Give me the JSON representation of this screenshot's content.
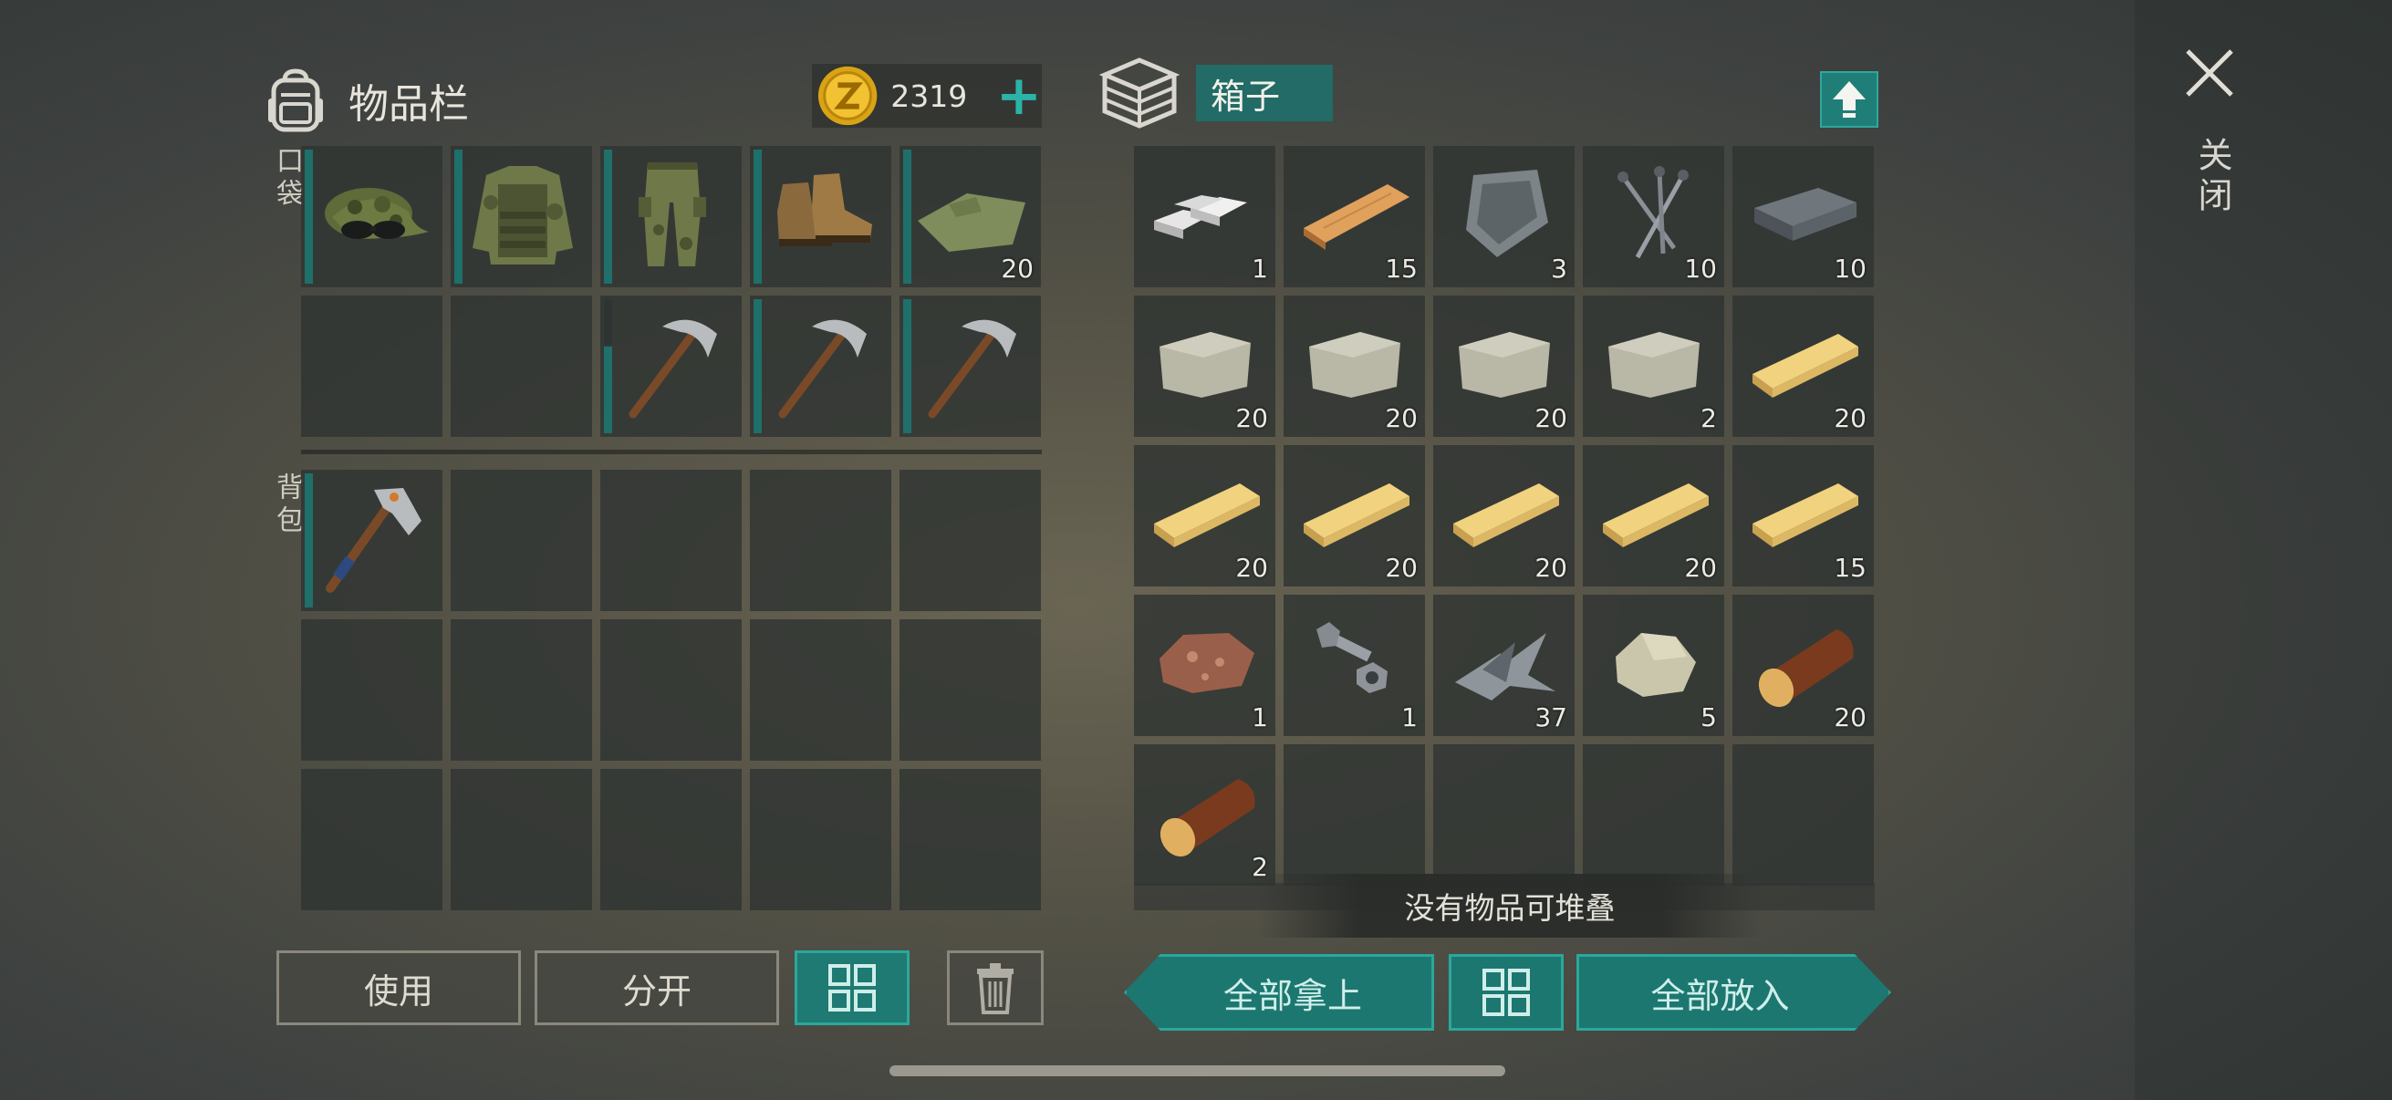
{
  "inventory": {
    "title": "物品栏",
    "coins": "2319",
    "plus": "+",
    "pocket_label": "口袋",
    "bag_label": "背包",
    "pocket_row1": [
      {
        "item": "camo-cap",
        "qty": ""
      },
      {
        "item": "camo-vest-jacket",
        "qty": ""
      },
      {
        "item": "camo-pants",
        "qty": ""
      },
      {
        "item": "leather-boots",
        "qty": ""
      },
      {
        "item": "cloth",
        "qty": "20"
      }
    ],
    "pocket_row2": [
      {
        "item": "empty",
        "qty": ""
      },
      {
        "item": "empty",
        "qty": ""
      },
      {
        "item": "pickaxe",
        "qty": ""
      },
      {
        "item": "pickaxe",
        "qty": ""
      },
      {
        "item": "pickaxe",
        "qty": ""
      }
    ],
    "bag_items": [
      {
        "item": "hatchet",
        "qty": ""
      }
    ]
  },
  "chest": {
    "title": "箱子",
    "items": [
      {
        "item": "aluminum-ingots",
        "qty": "1"
      },
      {
        "item": "wood-plank",
        "qty": "15"
      },
      {
        "item": "metal-plate",
        "qty": "3"
      },
      {
        "item": "nails",
        "qty": "10"
      },
      {
        "item": "iron-ingot",
        "qty": "10"
      },
      {
        "item": "stone",
        "qty": "20"
      },
      {
        "item": "stone",
        "qty": "20"
      },
      {
        "item": "stone",
        "qty": "20"
      },
      {
        "item": "stone",
        "qty": "2"
      },
      {
        "item": "pine-plank",
        "qty": "20"
      },
      {
        "item": "pine-plank",
        "qty": "20"
      },
      {
        "item": "pine-plank",
        "qty": "20"
      },
      {
        "item": "pine-plank",
        "qty": "20"
      },
      {
        "item": "pine-plank",
        "qty": "20"
      },
      {
        "item": "pine-plank",
        "qty": "15"
      },
      {
        "item": "iron-ore",
        "qty": "1"
      },
      {
        "item": "bolt-and-nut",
        "qty": "1"
      },
      {
        "item": "scrap-metal",
        "qty": "37"
      },
      {
        "item": "limestone",
        "qty": "5"
      },
      {
        "item": "log",
        "qty": "20"
      },
      {
        "item": "log",
        "qty": "2"
      }
    ],
    "toast": "没有物品可堆叠"
  },
  "buttons": {
    "use": "使用",
    "split": "分开",
    "take_all": "全部拿上",
    "put_all": "全部放入"
  },
  "close_label": "关闭",
  "colors": {
    "accent_teal": "#1e7a73",
    "accent_border": "#2aa89c",
    "slot_bg": "#303432"
  }
}
